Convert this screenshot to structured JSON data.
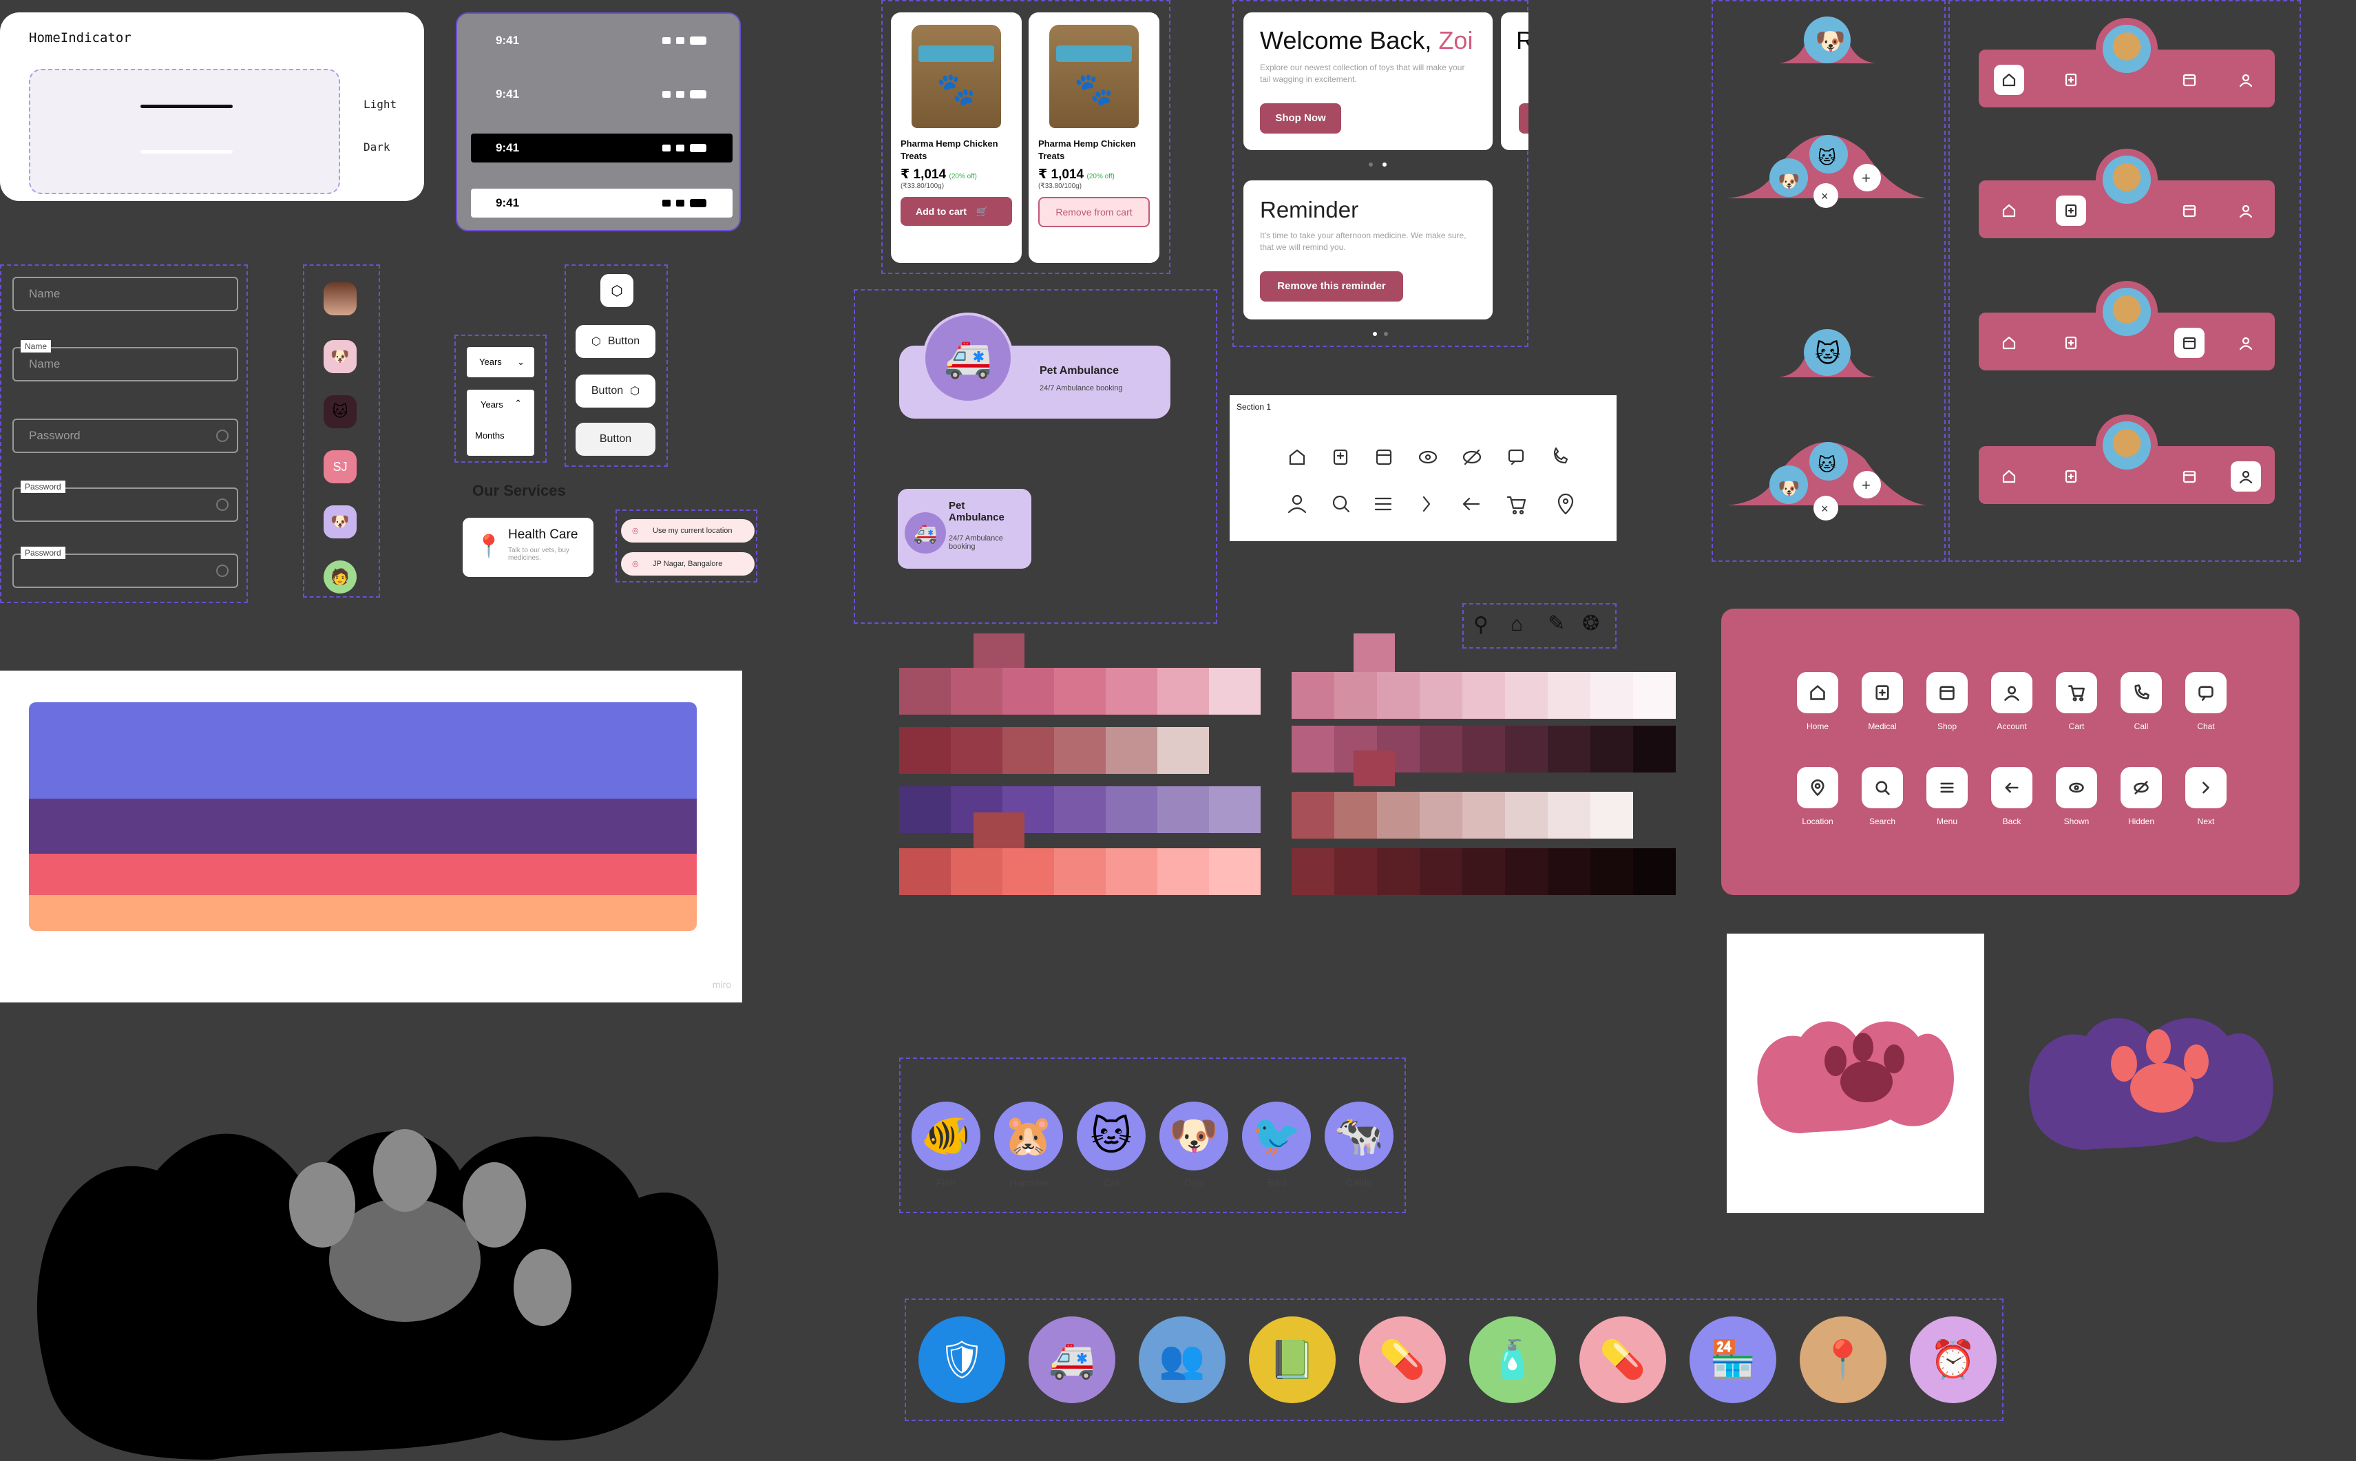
{
  "home_indicator": {
    "title": "HomeIndicator",
    "light": "Light",
    "dark": "Dark"
  },
  "status_bars": [
    {
      "time": "9:41",
      "theme": "gray-dark"
    },
    {
      "time": "9:41",
      "theme": "gray-light"
    },
    {
      "time": "9:41",
      "theme": "black"
    },
    {
      "time": "9:41",
      "theme": "white"
    }
  ],
  "inputs": [
    {
      "placeholder": "Name",
      "label": ""
    },
    {
      "placeholder": "Name",
      "label": "Name"
    },
    {
      "placeholder": "Password",
      "label": ""
    },
    {
      "placeholder": "Password",
      "label": "Password"
    },
    {
      "placeholder": "Password",
      "label": "Password"
    }
  ],
  "avatars": [
    {
      "icon": "person-photo-icon",
      "text": ""
    },
    {
      "icon": "pets-photo-icon",
      "text": ""
    },
    {
      "icon": "dark-pet-icon",
      "text": ""
    },
    {
      "icon": "initials-avatar",
      "text": "SJ"
    },
    {
      "icon": "dog-avatar-icon",
      "text": ""
    },
    {
      "icon": "man-avatar-icon",
      "text": ""
    }
  ],
  "dropdowns": {
    "closed_value": "Years",
    "open_value": "Years",
    "open_option": "Months"
  },
  "buttons": {
    "label1": "Button",
    "label2": "Button",
    "label3": "Button"
  },
  "services": {
    "heading": "Our Services",
    "card_title": "Health Care",
    "card_sub": "Talk to our vets, buy medicines.",
    "location_chip1": "Use my current location",
    "location_chip2": "JP Nagar, Bangalore"
  },
  "products": [
    {
      "name": "Pharma Hemp Chicken Treats",
      "price": "₹ 1,014",
      "discount": "(20% off)",
      "unit": "(₹33.80/100g)",
      "action": "Add to cart"
    },
    {
      "name": "Pharma Hemp Chicken Treats",
      "price": "₹ 1,014",
      "discount": "(20% off)",
      "unit": "(₹33.80/100g)",
      "action": "Remove from cart"
    }
  ],
  "welcome": {
    "greeting": "Welcome Back,",
    "name": "Zoi",
    "sub": "Explore our newest collection of toys that will make your tail wagging in excitement.",
    "cta": "Shop Now",
    "peek": "R"
  },
  "reminder": {
    "title": "Reminder",
    "sub": "It's time to take your afternoon medicine. We make sure, that we will remind you.",
    "cta": "Remove this reminder"
  },
  "ambulance": {
    "title": "Pet Ambulance",
    "sub": "24/7 Ambulance booking",
    "small_title": "Pet Ambulance",
    "small_sub": "24/7 Ambulance booking"
  },
  "section": {
    "label": "Section 1"
  },
  "nav_labels": {
    "row1": [
      "Home",
      "Medical",
      "Shop",
      "Account",
      "Cart",
      "Call",
      "Chat"
    ],
    "row2": [
      "Location",
      "Search",
      "Menu",
      "Back",
      "Shown",
      "Hidden",
      "Next"
    ]
  },
  "palettes": {
    "rose": [
      "#a24e63",
      "#b85a72",
      "#c96582",
      "#d7758f",
      "#de8aa0",
      "#e8a8b8",
      "#f2cfd8"
    ],
    "maroon": [
      "#8a2f3c",
      "#973a47",
      "#a65058",
      "#b36b6f",
      "#c39393",
      "#e1cbc9"
    ],
    "purple": [
      "#4a3278",
      "#5a3a8a",
      "#6a48a0",
      "#7a5aa8",
      "#8a70b4",
      "#9b86be",
      "#a897c8"
    ],
    "coral": [
      "#c4504f",
      "#e0655f",
      "#ee726a",
      "#f3867f",
      "#f89a93",
      "#fdaeaa",
      "#ffbcb8"
    ],
    "pink_light": [
      "#cc7d95",
      "#d48fa3",
      "#dc9fb2",
      "#e3b0bf",
      "#ebc2ce",
      "#f0d2da",
      "#f5e2e7",
      "#f9eef1",
      "#fdf6f8"
    ],
    "plum_dark": [
      "#b5607f",
      "#a04f6d",
      "#8c4360",
      "#77384f",
      "#632e42",
      "#4f2636",
      "#3b1d28",
      "#2a151c",
      "#180b0f"
    ],
    "brick": [
      "#a85057",
      "#b5736f",
      "#c3938f",
      "#cfa9a7",
      "#dbbcbb",
      "#e5d0d0",
      "#efe1e1",
      "#f7eeee"
    ],
    "burgundy": [
      "#7d2d35",
      "#6a252c",
      "#5a1f25",
      "#4b1a20",
      "#3c151a",
      "#2f1115",
      "#230c10",
      "#17080a",
      "#0d0506"
    ]
  },
  "pets": [
    "Fish",
    "Hamster",
    "Cat",
    "Dog",
    "Bird",
    "Cattle"
  ],
  "feature_icons": [
    "shield-plus-icon",
    "ambulance-icon",
    "vet-team-icon",
    "records-icon",
    "pill-icon",
    "bottle-icon",
    "capsule-icon",
    "pet-shop-icon",
    "location-paw-icon",
    "alarm-clock-icon"
  ],
  "miro_watermark": "miro",
  "colors": {
    "brand": "#c05a78",
    "brand_dark": "#a84a62",
    "lavender": "#d6c5f0",
    "periwinkle": "#8e8cf0",
    "canvas": "#3d3d3d"
  }
}
